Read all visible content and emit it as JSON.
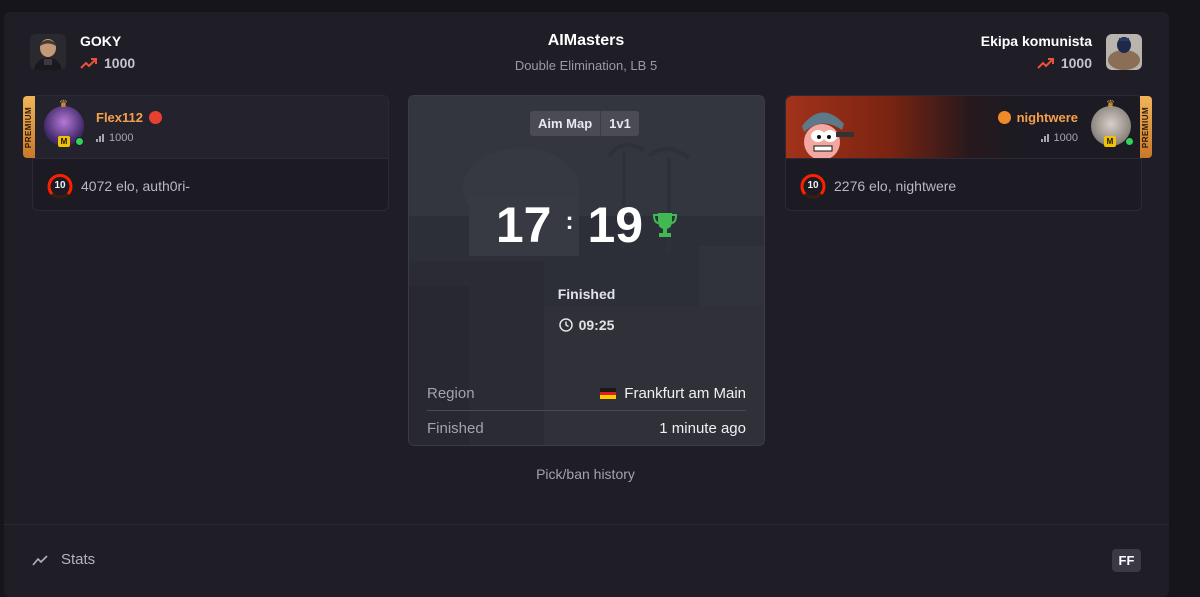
{
  "header": {
    "team_left": {
      "name": "GOKY",
      "elo": "1000"
    },
    "team_right": {
      "name": "Ekipa komunista",
      "elo": "1000"
    },
    "competition": {
      "name": "AIMasters",
      "subtitle": "Double Elimination, LB 5"
    }
  },
  "players": [
    {
      "name": "Flex112",
      "elo": "1000",
      "badge": "PREMIUM",
      "membership": "M",
      "level": "10",
      "level_label": "4072 elo, auth0ri-"
    },
    {
      "name": "nightwere",
      "elo": "1000",
      "badge": "PREMIUM",
      "membership": "M",
      "level": "10",
      "level_label": "2276 elo, nightwere"
    }
  ],
  "match": {
    "map": "Aim Map",
    "mode": "1v1",
    "score_left": "17",
    "score_sep": ":",
    "score_right": "19",
    "status": "Finished",
    "duration": "09:25",
    "region_label": "Region",
    "region_value": "Frankfurt am Main",
    "finished_label": "Finished",
    "finished_value": "1 minute ago"
  },
  "pickban": "Pick/ban history",
  "footer": {
    "stats_label": "Stats",
    "ff_badge": "FF"
  },
  "colors": {
    "accent_orange": "#f7a04b",
    "premium_gold": "#e6a642",
    "trophy_green": "#3fb950",
    "trend_red": "#e8523a",
    "online_green": "#32d35a"
  },
  "icons": [
    "trend-up-icon",
    "crown-icon",
    "angry-face-icon",
    "happy-face-icon",
    "bars-icon",
    "level-10-icon",
    "trophy-icon",
    "clock-icon",
    "germany-flag-icon",
    "stats-chart-icon"
  ]
}
